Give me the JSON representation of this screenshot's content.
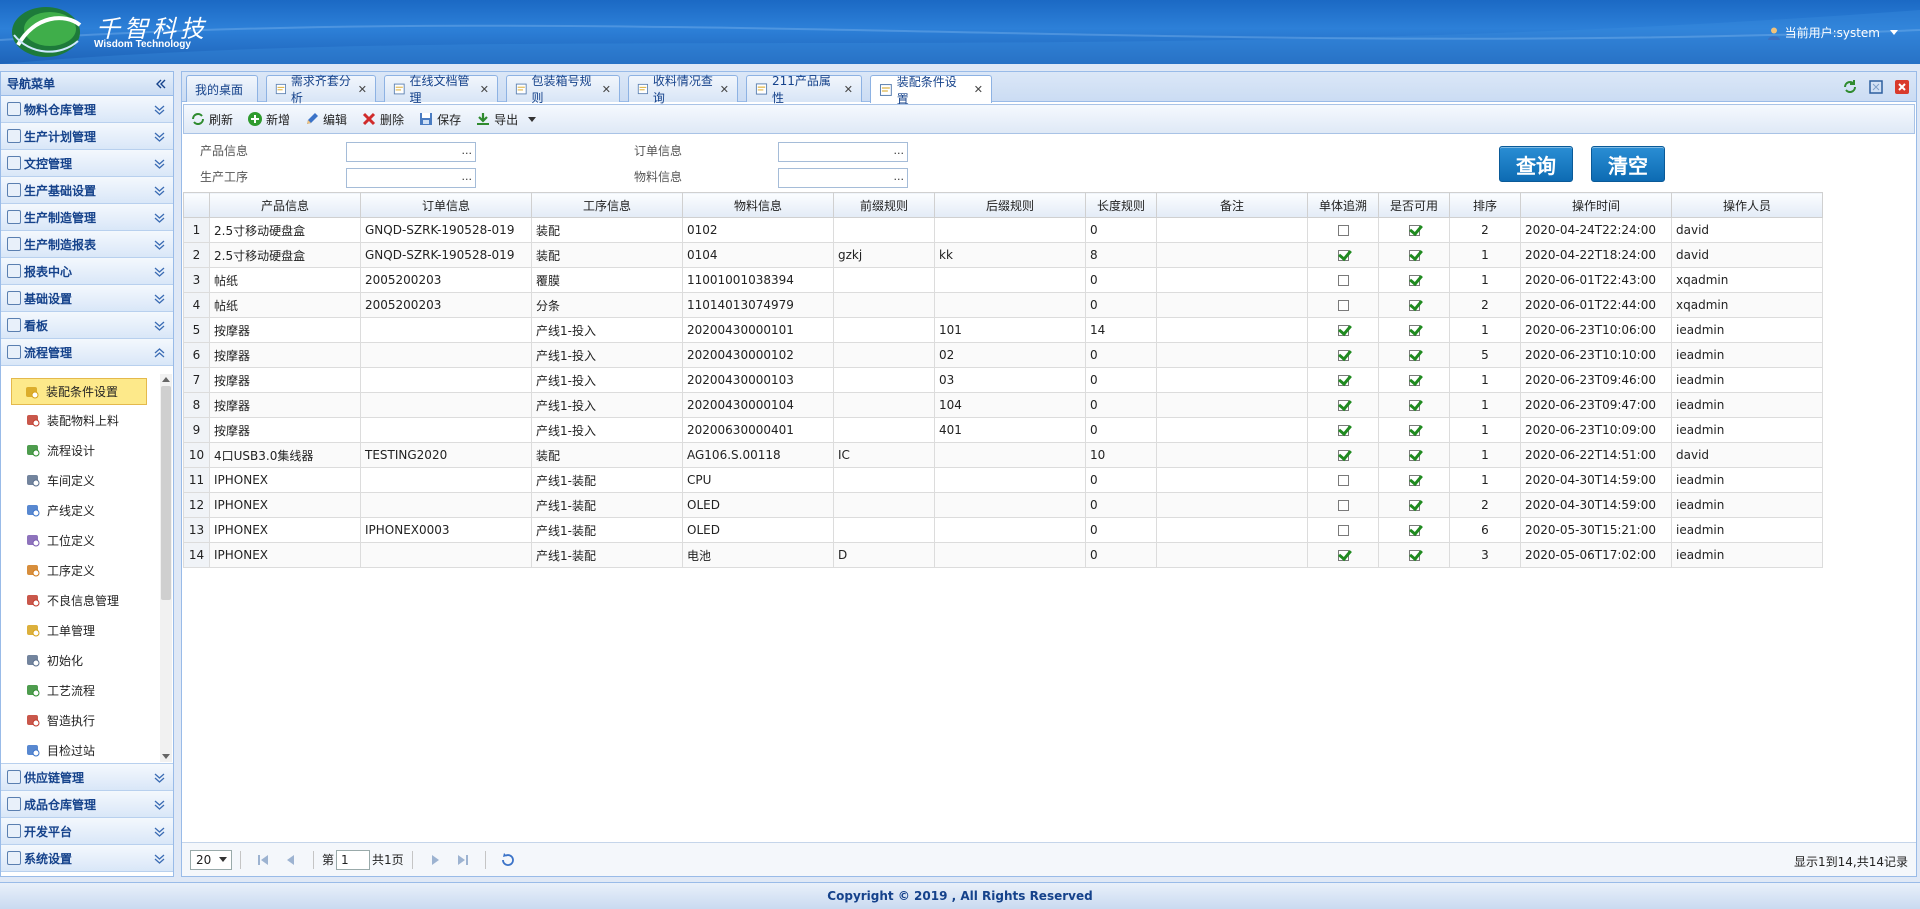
{
  "header": {
    "logo_cn": "千智科技",
    "logo_en": "Wisdom Technology",
    "current_user": "当前用户:system"
  },
  "sidebar": {
    "title": "导航菜单",
    "sections_top": [
      {
        "label": "物料仓库管理",
        "icon": "warehouse-icon"
      },
      {
        "label": "生产计划管理",
        "icon": "plan-icon"
      },
      {
        "label": "文控管理",
        "icon": "document-icon"
      },
      {
        "label": "生产基础设置",
        "icon": "settings-icon"
      },
      {
        "label": "生产制造管理",
        "icon": "factory-icon"
      },
      {
        "label": "生产制造报表",
        "icon": "report-icon"
      },
      {
        "label": "报表中心",
        "icon": "chart-icon"
      },
      {
        "label": "基础设置",
        "icon": "base-icon"
      },
      {
        "label": "看板",
        "icon": "board-icon"
      },
      {
        "label": "流程管理",
        "icon": "flow-icon"
      }
    ],
    "flow_items": [
      {
        "label": "装配条件设置",
        "icon": "gear-icon",
        "active": true
      },
      {
        "label": "装配物料上料",
        "icon": "material-icon"
      },
      {
        "label": "流程设计",
        "icon": "flow-design-icon"
      },
      {
        "label": "车间定义",
        "icon": "workshop-icon"
      },
      {
        "label": "产线定义",
        "icon": "line-icon"
      },
      {
        "label": "工位定义",
        "icon": "station-icon"
      },
      {
        "label": "工序定义",
        "icon": "process-icon"
      },
      {
        "label": "不良信息管理",
        "icon": "defect-icon"
      },
      {
        "label": "工单管理",
        "icon": "order-icon"
      },
      {
        "label": "初始化",
        "icon": "init-icon"
      },
      {
        "label": "工艺流程",
        "icon": "craft-icon"
      },
      {
        "label": "智造执行",
        "icon": "execute-icon"
      },
      {
        "label": "目检过站",
        "icon": "eye-icon"
      }
    ],
    "sections_bottom": [
      {
        "label": "供应链管理",
        "icon": "supply-icon"
      },
      {
        "label": "成品仓库管理",
        "icon": "product-icon"
      },
      {
        "label": "开发平台",
        "icon": "dev-icon"
      },
      {
        "label": "系统设置",
        "icon": "system-icon"
      }
    ]
  },
  "tabs": [
    {
      "label": "我的桌面",
      "closable": false
    },
    {
      "label": "需求齐套分析",
      "closable": true
    },
    {
      "label": "在线文档管理",
      "closable": true
    },
    {
      "label": "包装箱号规则",
      "closable": true
    },
    {
      "label": "收料情况查询",
      "closable": true
    },
    {
      "label": "211产品属性",
      "closable": true
    },
    {
      "label": "装配条件设置",
      "closable": true,
      "active": true
    }
  ],
  "toolbar": {
    "refresh": "刷新",
    "add": "新增",
    "edit": "编辑",
    "delete": "删除",
    "save": "保存",
    "export": "导出"
  },
  "search": {
    "product_label": "产品信息",
    "order_label": "订单信息",
    "process_label": "生产工序",
    "material_label": "物料信息",
    "dots": "...",
    "query_button": "查询",
    "clear_button": "清空"
  },
  "grid": {
    "columns": [
      "产品信息",
      "订单信息",
      "工序信息",
      "物料信息",
      "前缀规则",
      "后缀规则",
      "长度规则",
      "备注",
      "单体追溯",
      "是否可用",
      "排序",
      "操作时间",
      "操作人员"
    ],
    "rows": [
      {
        "n": "1",
        "product": "2.5寸移动硬盘盒",
        "order": "GNQD-SZRK-190528-019",
        "process": "装配",
        "material": "0102",
        "prefix": "",
        "suffix": "",
        "length": "0",
        "remark": "",
        "trace": false,
        "enabled": true,
        "sort": "2",
        "time": "2020-04-24T22:24:00",
        "user": "david"
      },
      {
        "n": "2",
        "product": "2.5寸移动硬盘盒",
        "order": "GNQD-SZRK-190528-019",
        "process": "装配",
        "material": "0104",
        "prefix": "gzkj",
        "suffix": "kk",
        "length": "8",
        "remark": "",
        "trace": true,
        "enabled": true,
        "sort": "1",
        "time": "2020-04-22T18:24:00",
        "user": "david"
      },
      {
        "n": "3",
        "product": "帖纸",
        "order": "2005200203",
        "process": "覆膜",
        "material": "11001001038394",
        "prefix": "",
        "suffix": "",
        "length": "0",
        "remark": "",
        "trace": false,
        "enabled": true,
        "sort": "1",
        "time": "2020-06-01T22:43:00",
        "user": "xqadmin"
      },
      {
        "n": "4",
        "product": "帖纸",
        "order": "2005200203",
        "process": "分条",
        "material": "11014013074979",
        "prefix": "",
        "suffix": "",
        "length": "0",
        "remark": "",
        "trace": false,
        "enabled": true,
        "sort": "2",
        "time": "2020-06-01T22:44:00",
        "user": "xqadmin"
      },
      {
        "n": "5",
        "product": "按摩器",
        "order": "",
        "process": "产线1-投入",
        "material": "20200430000101",
        "prefix": "",
        "suffix": "101",
        "length": "14",
        "remark": "",
        "trace": true,
        "enabled": true,
        "sort": "1",
        "time": "2020-06-23T10:06:00",
        "user": "ieadmin"
      },
      {
        "n": "6",
        "product": "按摩器",
        "order": "",
        "process": "产线1-投入",
        "material": "20200430000102",
        "prefix": "",
        "suffix": "02",
        "length": "0",
        "remark": "",
        "trace": true,
        "enabled": true,
        "sort": "5",
        "time": "2020-06-23T10:10:00",
        "user": "ieadmin"
      },
      {
        "n": "7",
        "product": "按摩器",
        "order": "",
        "process": "产线1-投入",
        "material": "20200430000103",
        "prefix": "",
        "suffix": "03",
        "length": "0",
        "remark": "",
        "trace": true,
        "enabled": true,
        "sort": "1",
        "time": "2020-06-23T09:46:00",
        "user": "ieadmin"
      },
      {
        "n": "8",
        "product": "按摩器",
        "order": "",
        "process": "产线1-投入",
        "material": "20200430000104",
        "prefix": "",
        "suffix": "104",
        "length": "0",
        "remark": "",
        "trace": true,
        "enabled": true,
        "sort": "1",
        "time": "2020-06-23T09:47:00",
        "user": "ieadmin"
      },
      {
        "n": "9",
        "product": "按摩器",
        "order": "",
        "process": "产线1-投入",
        "material": "20200630000401",
        "prefix": "",
        "suffix": "401",
        "length": "0",
        "remark": "",
        "trace": true,
        "enabled": true,
        "sort": "1",
        "time": "2020-06-23T10:09:00",
        "user": "ieadmin"
      },
      {
        "n": "10",
        "product": "4口USB3.0集线器",
        "order": "TESTING2020",
        "process": "装配",
        "material": "AG106.S.00118",
        "prefix": "IC",
        "suffix": "",
        "length": "10",
        "remark": "",
        "trace": true,
        "enabled": true,
        "sort": "1",
        "time": "2020-06-22T14:51:00",
        "user": "david"
      },
      {
        "n": "11",
        "product": "IPHONEX",
        "order": "",
        "process": "产线1-装配",
        "material": "CPU",
        "prefix": "",
        "suffix": "",
        "length": "0",
        "remark": "",
        "trace": false,
        "enabled": true,
        "sort": "1",
        "time": "2020-04-30T14:59:00",
        "user": "ieadmin"
      },
      {
        "n": "12",
        "product": "IPHONEX",
        "order": "",
        "process": "产线1-装配",
        "material": "OLED",
        "prefix": "",
        "suffix": "",
        "length": "0",
        "remark": "",
        "trace": false,
        "enabled": true,
        "sort": "2",
        "time": "2020-04-30T14:59:00",
        "user": "ieadmin"
      },
      {
        "n": "13",
        "product": "IPHONEX",
        "order": "IPHONEX0003",
        "process": "产线1-装配",
        "material": "OLED",
        "prefix": "",
        "suffix": "",
        "length": "0",
        "remark": "",
        "trace": false,
        "enabled": true,
        "sort": "6",
        "time": "2020-05-30T15:21:00",
        "user": "ieadmin"
      },
      {
        "n": "14",
        "product": "IPHONEX",
        "order": "",
        "process": "产线1-装配",
        "material": "电池",
        "prefix": "D",
        "suffix": "",
        "length": "0",
        "remark": "",
        "trace": true,
        "enabled": true,
        "sort": "3",
        "time": "2020-05-06T17:02:00",
        "user": "ieadmin"
      }
    ]
  },
  "pager": {
    "page_size": "20",
    "page_prefix": "第",
    "page_value": "1",
    "page_total": "共1页",
    "info": "显示1到14,共14记录"
  },
  "footer": {
    "copyright": "Copyright © 2019 , All Rights Reserved"
  }
}
